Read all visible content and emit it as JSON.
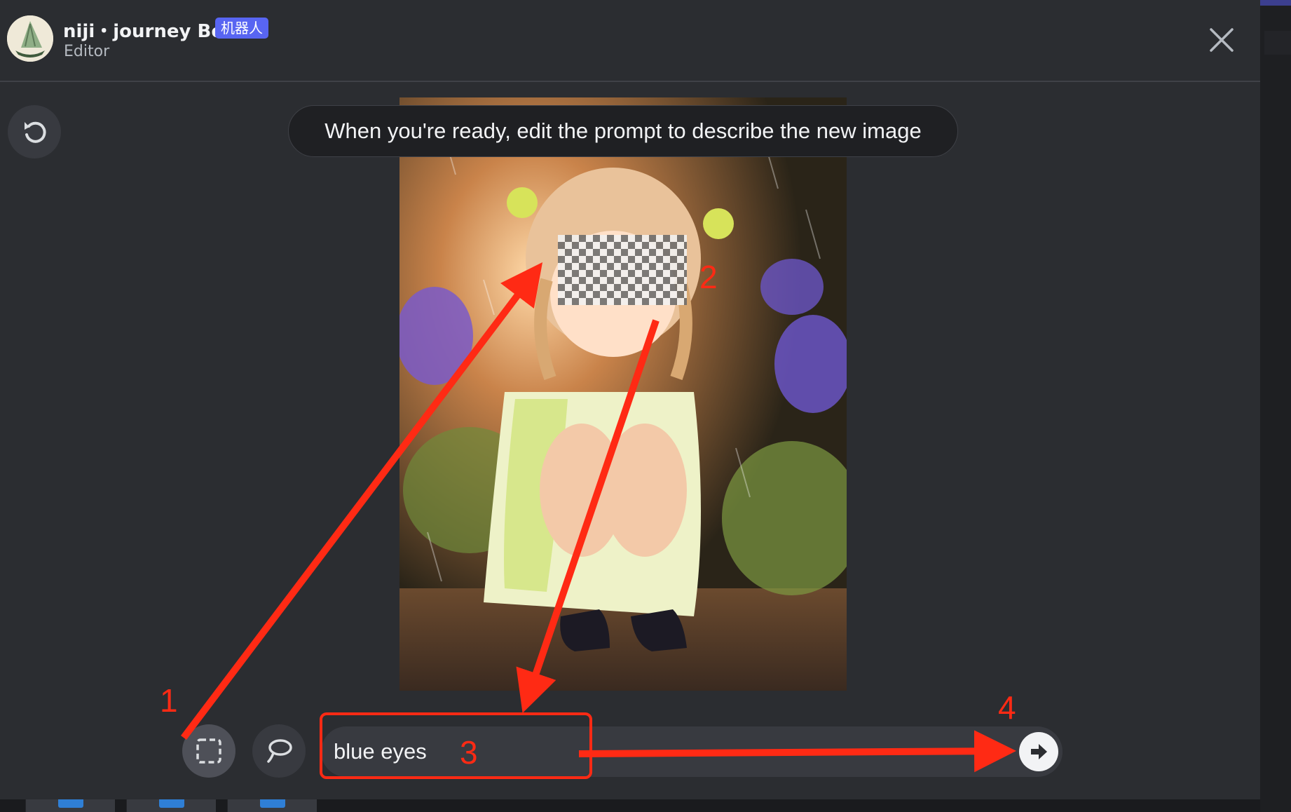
{
  "header": {
    "bot_name": "niji・journey Bot",
    "bot_badge": "机器人",
    "subtitle": "Editor"
  },
  "tooltip": {
    "text": "When you're ready, edit the prompt to describe the new image"
  },
  "prompt": {
    "value": "blue eyes"
  },
  "annotations": [
    "1",
    "2",
    "3",
    "4"
  ],
  "colors": {
    "background": "#2b2d31",
    "badge": "#5865f2",
    "annotation": "#ff2a14",
    "prompt_bar": "#383a40"
  },
  "icons": {
    "avatar": "sailboat-logo-icon",
    "close": "close-icon",
    "undo": "undo-icon",
    "rect_select": "rectangle-select-icon",
    "lasso": "lasso-icon",
    "submit": "arrow-right-icon"
  }
}
